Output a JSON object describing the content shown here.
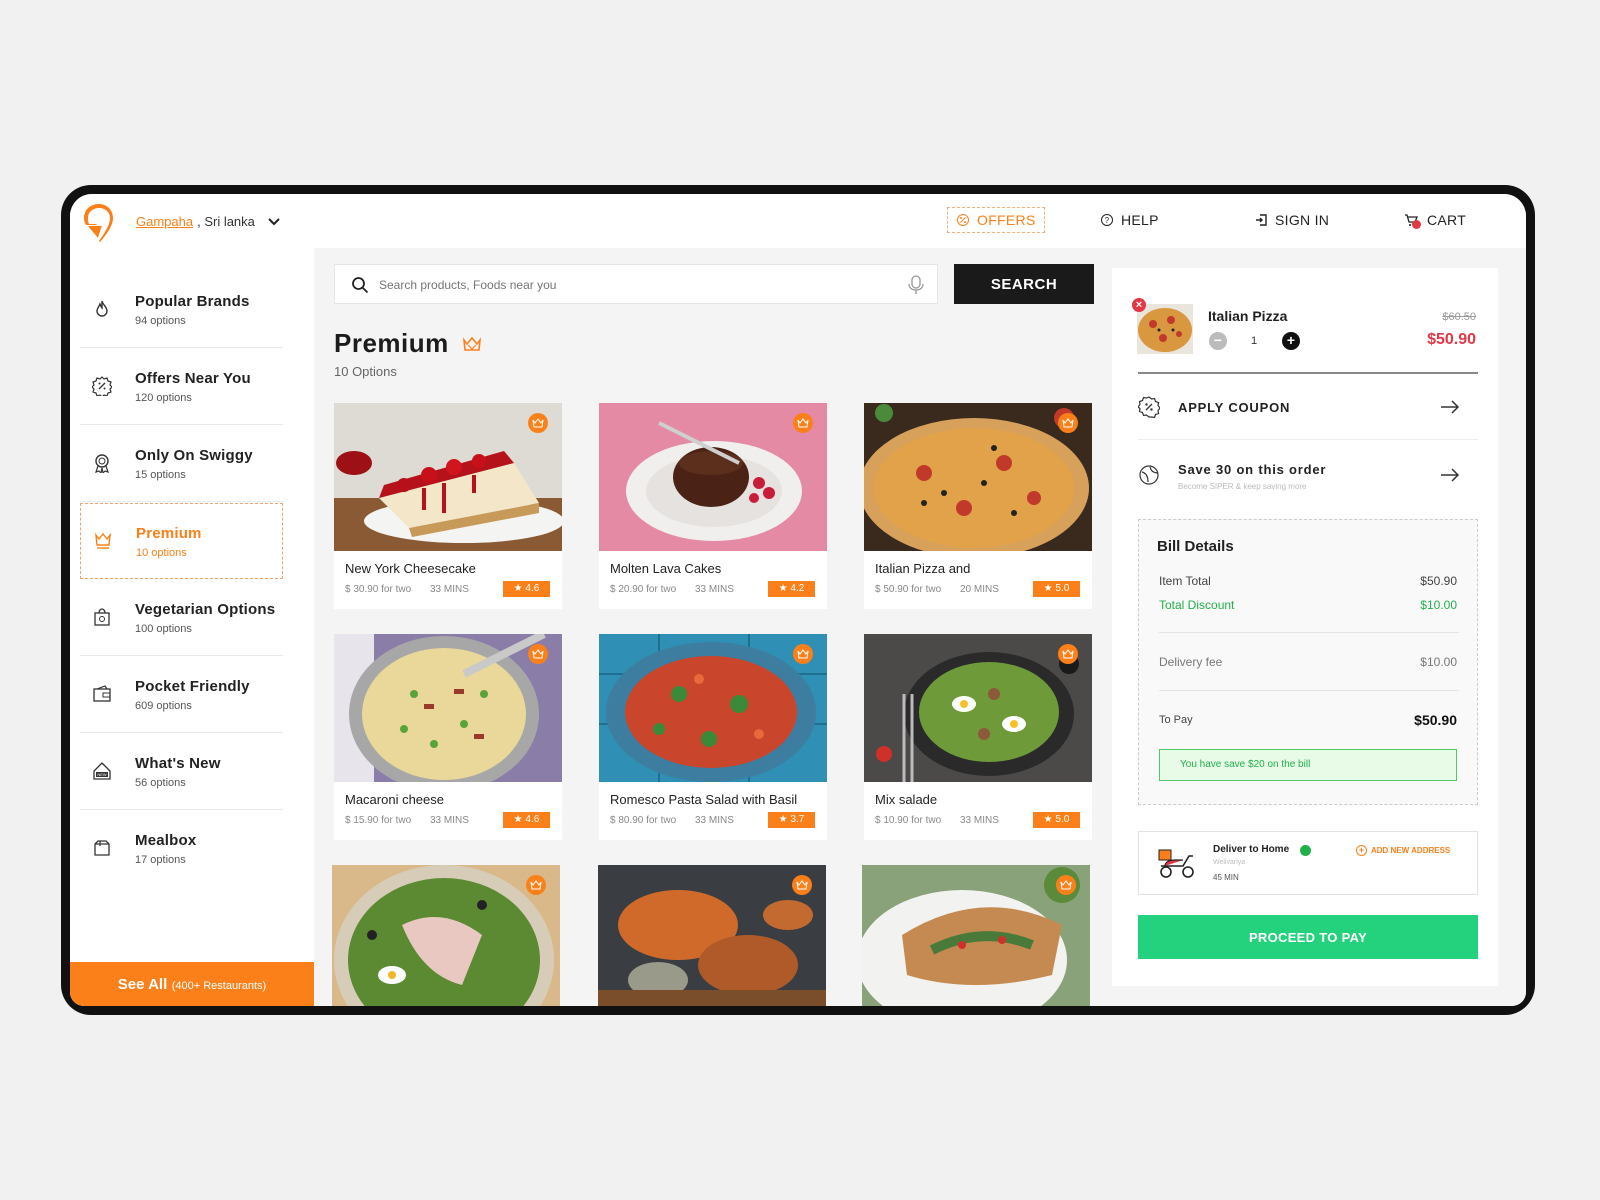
{
  "header": {
    "location_city": "Gampaha",
    "location_rest": ", Sri lanka",
    "nav": {
      "offers": "OFFERS",
      "help": "HELP",
      "sign_in": "SIGN IN",
      "cart": "CART"
    }
  },
  "sidebar": {
    "items": [
      {
        "title": "Popular  Brands",
        "sub": "94 options",
        "icon": "flame-icon"
      },
      {
        "title": "Offers Near You",
        "sub": "120 options",
        "icon": "discount-icon"
      },
      {
        "title": "Only On Swiggy",
        "sub": "15 options",
        "icon": "award-icon"
      },
      {
        "title": "Premium",
        "sub": "10 options",
        "icon": "premium-icon",
        "active": true
      },
      {
        "title": "Vegetarian Options",
        "sub": "100 options",
        "icon": "veg-icon"
      },
      {
        "title": "Pocket Friendly",
        "sub": "609 options",
        "icon": "wallet-icon"
      },
      {
        "title": "What's New",
        "sub": "56 options",
        "icon": "new-icon"
      },
      {
        "title": "Mealbox",
        "sub": "17 options",
        "icon": "box-icon"
      }
    ],
    "see_all": "See All",
    "see_all_sub": "(400+ Restaurants)"
  },
  "main": {
    "search": {
      "placeholder": "Search products, Foods near you",
      "button": "SEARCH"
    },
    "title": "Premium",
    "subtitle": "10 Options",
    "cards": [
      {
        "name": "New York Cheesecake",
        "price": "$ 30.90 for two",
        "time": "33 MINS",
        "rating": "4.6"
      },
      {
        "name": "Molten Lava Cakes",
        "price": "$ 20.90 for two",
        "time": "33 MINS",
        "rating": "4.2"
      },
      {
        "name": "Italian Pizza and",
        "price": "$ 50.90 for two",
        "time": "20 MINS",
        "rating": "5.0"
      },
      {
        "name": "Macaroni cheese",
        "price": "$ 15.90 for two",
        "time": "33 MINS",
        "rating": "4.6"
      },
      {
        "name": "Romesco Pasta Salad with Basil",
        "price": "$ 80.90 for two",
        "time": "33 MINS",
        "rating": "3.7"
      },
      {
        "name": "Mix salade",
        "price": "$ 10.90 for two",
        "time": "33 MINS",
        "rating": "5.0"
      }
    ]
  },
  "cart": {
    "item": {
      "name": "Italian Pizza",
      "qty": "1",
      "old_price": "$60.50",
      "price": "$50.90"
    },
    "coupon": "APPLY COUPON",
    "save": {
      "title": "Save 30 on this order",
      "sub": "Become SIPER & keep saving more"
    },
    "bill": {
      "title": "Bill Details",
      "item_total_label": "Item Total",
      "item_total": "$50.90",
      "discount_label": "Total Discount",
      "discount": "$10.00",
      "delivery_label": "Delivery fee",
      "delivery": "$10.00",
      "to_pay_label": "To Pay",
      "to_pay": "$50.90",
      "save_note": "You have save $20 on the bill"
    },
    "deliver": {
      "title": "Deliver to Home",
      "location": "Welivariya",
      "time": "45 MIN",
      "add_address": "ADD NEW ADDRESS"
    },
    "proceed": "PROCEED TO PAY"
  },
  "colors": {
    "brand": "#fc8019",
    "accent_green": "#24d17d",
    "price_red": "#e23744"
  }
}
